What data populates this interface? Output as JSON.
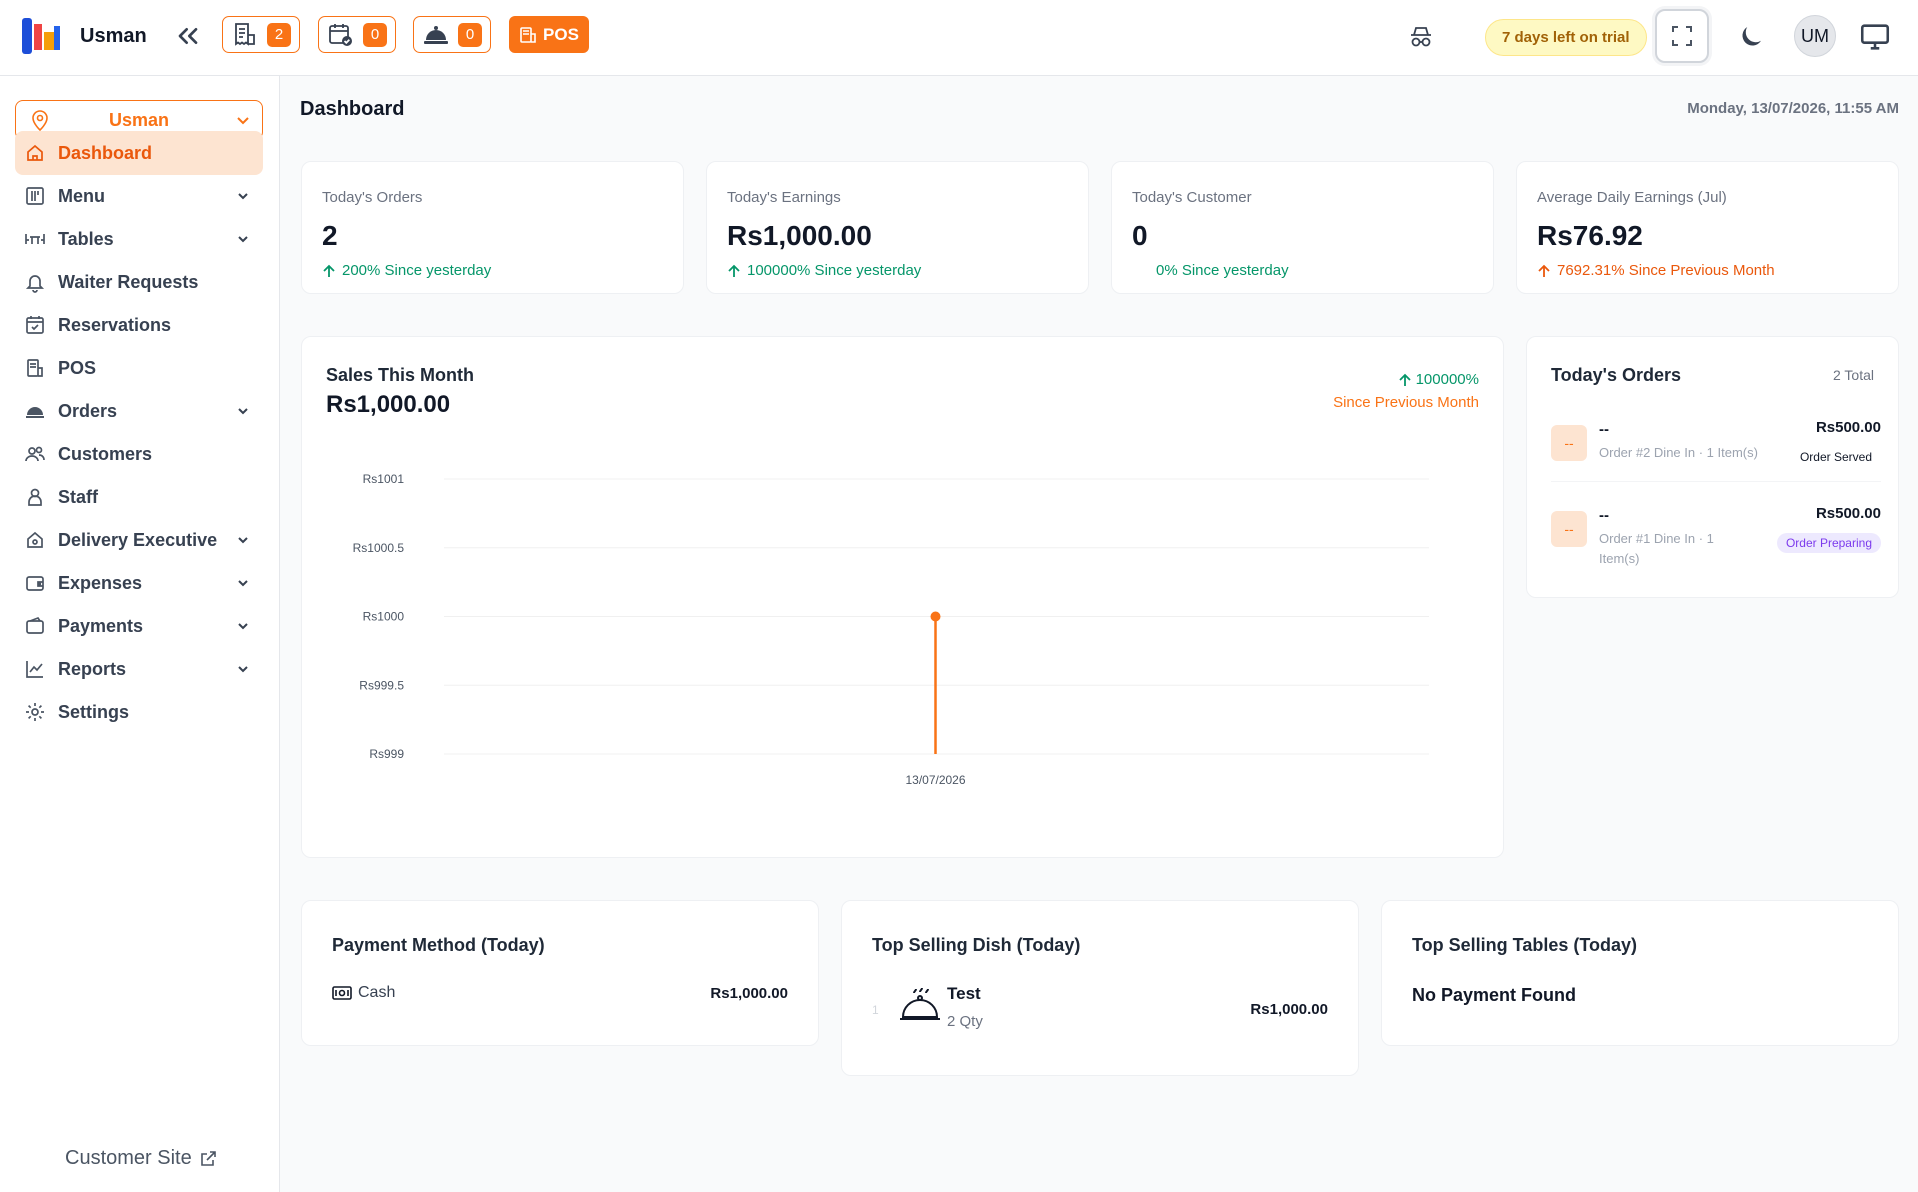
{
  "topbar": {
    "brand": "Usman",
    "badges": {
      "orders": "2",
      "reservations": "0",
      "waiter": "0"
    },
    "pos_label": "POS",
    "trial": "7 days left on trial",
    "avatar": "UM"
  },
  "sidebar": {
    "branch": "Usman",
    "items": [
      {
        "label": "Dashboard",
        "icon": "home-icon"
      },
      {
        "label": "Menu",
        "icon": "menu-book-icon"
      },
      {
        "label": "Tables",
        "icon": "table-icon"
      },
      {
        "label": "Waiter Requests",
        "icon": "bell-icon"
      },
      {
        "label": "Reservations",
        "icon": "calendar-check-icon"
      },
      {
        "label": "POS",
        "icon": "pos-icon"
      },
      {
        "label": "Orders",
        "icon": "cloche-icon"
      },
      {
        "label": "Customers",
        "icon": "users-icon"
      },
      {
        "label": "Staff",
        "icon": "user-icon"
      },
      {
        "label": "Delivery Executive",
        "icon": "delivery-icon"
      },
      {
        "label": "Expenses",
        "icon": "wallet-icon"
      },
      {
        "label": "Payments",
        "icon": "card-icon"
      },
      {
        "label": "Reports",
        "icon": "chart-icon"
      },
      {
        "label": "Settings",
        "icon": "gear-icon"
      }
    ],
    "customer_site": "Customer Site"
  },
  "page": {
    "title": "Dashboard",
    "datetime": "Monday, 13/07/2026, 11:55 AM"
  },
  "stats": [
    {
      "label": "Today's Orders",
      "value": "2",
      "change": "200% Since yesterday"
    },
    {
      "label": "Today's Earnings",
      "value": "Rs1,000.00",
      "change": "100000% Since yesterday"
    },
    {
      "label": "Today's Customer",
      "value": "0",
      "change": "0% Since yesterday"
    },
    {
      "label": "Average Daily Earnings (Jul)",
      "value": "Rs76.92",
      "change": "7692.31% Since Previous Month"
    }
  ],
  "sales": {
    "title": "Sales This Month",
    "value": "Rs1,000.00",
    "pct": "100000%",
    "sub": "Since Previous Month"
  },
  "chart_data": {
    "type": "line",
    "x": [
      "13/07/2026"
    ],
    "series": [
      {
        "values": [
          1000
        ]
      }
    ],
    "ylim": [
      999,
      1001
    ],
    "yticks": [
      "Rs1001",
      "Rs1000.5",
      "Rs1000",
      "Rs999.5",
      "Rs999"
    ],
    "xlabel": "",
    "ylabel": "",
    "grid": true,
    "color": "#f97316"
  },
  "today_orders": {
    "title": "Today's Orders",
    "total": "2 Total",
    "orders": [
      {
        "chip": "--",
        "name": "--",
        "desc": "Order #2 Dine In · 1 Item(s)",
        "amount": "Rs500.00",
        "status": "Order Served"
      },
      {
        "chip": "--",
        "name": "--",
        "desc": "Order #1 Dine In · 1 Item(s)",
        "amount": "Rs500.00",
        "status": "Order Preparing"
      }
    ]
  },
  "payment_method": {
    "title": "Payment Method (Today)",
    "method": "Cash",
    "amount": "Rs1,000.00"
  },
  "top_dish": {
    "title": "Top Selling Dish (Today)",
    "rank": "1",
    "name": "Test",
    "qty": "2 Qty",
    "amount": "Rs1,000.00"
  },
  "top_tables": {
    "title": "Top Selling Tables (Today)",
    "empty": "No Payment Found"
  }
}
